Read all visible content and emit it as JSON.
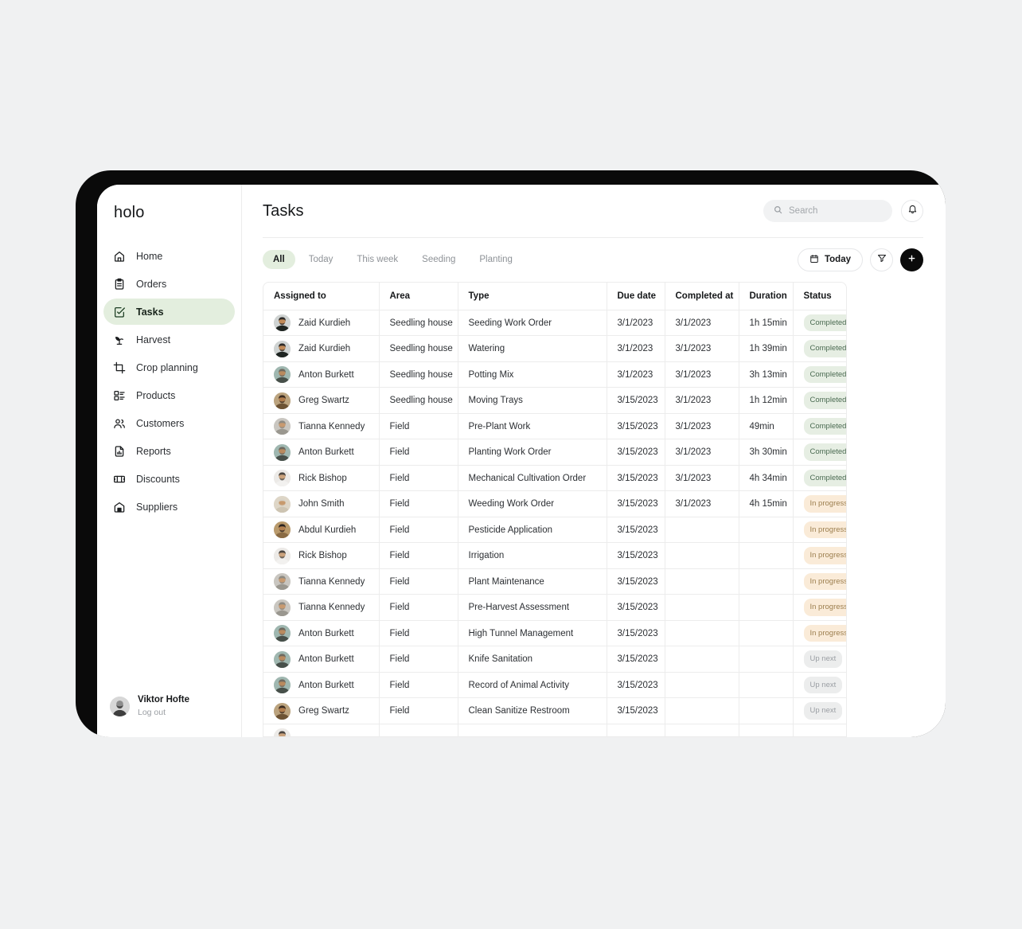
{
  "brand": "holo",
  "sidebar": {
    "items": [
      {
        "label": "Home",
        "icon": "home-icon",
        "active": false
      },
      {
        "label": "Orders",
        "icon": "clipboard-icon",
        "active": false
      },
      {
        "label": "Tasks",
        "icon": "task-check-icon",
        "active": true
      },
      {
        "label": "Harvest",
        "icon": "sprout-icon",
        "active": false
      },
      {
        "label": "Crop planning",
        "icon": "crop-icon",
        "active": false
      },
      {
        "label": "Products",
        "icon": "list-boxes-icon",
        "active": false
      },
      {
        "label": "Customers",
        "icon": "users-icon",
        "active": false
      },
      {
        "label": "Reports",
        "icon": "report-chart-icon",
        "active": false
      },
      {
        "label": "Discounts",
        "icon": "ticket-icon",
        "active": false
      },
      {
        "label": "Suppliers",
        "icon": "warehouse-icon",
        "active": false
      }
    ],
    "profile": {
      "name": "Viktor Hofte",
      "action": "Log out"
    }
  },
  "header": {
    "title": "Tasks",
    "search": {
      "placeholder": "Search",
      "value": "",
      "icon": "search-icon"
    },
    "notifications_icon": "bell-icon"
  },
  "filters": {
    "chips": [
      {
        "label": "All",
        "active": true
      },
      {
        "label": "Today",
        "active": false
      },
      {
        "label": "This week",
        "active": false
      },
      {
        "label": "Seeding",
        "active": false
      },
      {
        "label": "Planting",
        "active": false
      }
    ],
    "today_button": {
      "label": "Today",
      "icon": "calendar-icon"
    },
    "filter_button": {
      "icon": "funnel-icon"
    },
    "add_button": {
      "icon": "plus-icon"
    }
  },
  "table": {
    "columns": [
      "Assigned to",
      "Area",
      "Type",
      "Due date",
      "Completed at",
      "Duration",
      "Status"
    ],
    "rows": [
      {
        "assigned_to": "Zaid Kurdieh",
        "avatar": 0,
        "area": "Seedling house",
        "type": "Seeding Work Order",
        "due_date": "3/1/2023",
        "completed_at": "3/1/2023",
        "duration": "1h 15min",
        "status": "Completed",
        "status_key": "completed"
      },
      {
        "assigned_to": "Zaid Kurdieh",
        "avatar": 0,
        "area": "Seedling house",
        "type": "Watering",
        "due_date": "3/1/2023",
        "completed_at": "3/1/2023",
        "duration": "1h 39min",
        "status": "Completed",
        "status_key": "completed"
      },
      {
        "assigned_to": "Anton Burkett",
        "avatar": 1,
        "area": "Seedling house",
        "type": "Potting Mix",
        "due_date": "3/1/2023",
        "completed_at": "3/1/2023",
        "duration": "3h 13min",
        "status": "Completed",
        "status_key": "completed"
      },
      {
        "assigned_to": "Greg Swartz",
        "avatar": 2,
        "area": "Seedling house",
        "type": "Moving Trays",
        "due_date": "3/15/2023",
        "completed_at": "3/1/2023",
        "duration": "1h 12min",
        "status": "Completed",
        "status_key": "completed"
      },
      {
        "assigned_to": "Tianna Kennedy",
        "avatar": 3,
        "area": "Field",
        "type": "Pre-Plant Work",
        "due_date": "3/15/2023",
        "completed_at": "3/1/2023",
        "duration": "49min",
        "status": "Completed",
        "status_key": "completed"
      },
      {
        "assigned_to": "Anton Burkett",
        "avatar": 1,
        "area": "Field",
        "type": "Planting Work Order",
        "due_date": "3/15/2023",
        "completed_at": "3/1/2023",
        "duration": "3h 30min",
        "status": "Completed",
        "status_key": "completed"
      },
      {
        "assigned_to": "Rick Bishop",
        "avatar": 4,
        "area": "Field",
        "type": "Mechanical Cultivation Order",
        "due_date": "3/15/2023",
        "completed_at": "3/1/2023",
        "duration": "4h 34min",
        "status": "Completed",
        "status_key": "completed"
      },
      {
        "assigned_to": "John Smith",
        "avatar": 5,
        "area": "Field",
        "type": "Weeding Work Order",
        "due_date": "3/15/2023",
        "completed_at": "3/1/2023",
        "duration": "4h 15min",
        "status": "In progress",
        "status_key": "inprogress"
      },
      {
        "assigned_to": "Abdul Kurdieh",
        "avatar": 6,
        "area": "Field",
        "type": "Pesticide Application",
        "due_date": "3/15/2023",
        "completed_at": "",
        "duration": "",
        "status": "In progress",
        "status_key": "inprogress"
      },
      {
        "assigned_to": "Rick Bishop",
        "avatar": 4,
        "area": "Field",
        "type": "Irrigation",
        "due_date": "3/15/2023",
        "completed_at": "",
        "duration": "",
        "status": "In progress",
        "status_key": "inprogress"
      },
      {
        "assigned_to": "Tianna Kennedy",
        "avatar": 3,
        "area": "Field",
        "type": "Plant Maintenance",
        "due_date": "3/15/2023",
        "completed_at": "",
        "duration": "",
        "status": "In progress",
        "status_key": "inprogress"
      },
      {
        "assigned_to": "Tianna Kennedy",
        "avatar": 3,
        "area": "Field",
        "type": "Pre-Harvest Assessment",
        "due_date": "3/15/2023",
        "completed_at": "",
        "duration": "",
        "status": "In progress",
        "status_key": "inprogress"
      },
      {
        "assigned_to": "Anton Burkett",
        "avatar": 1,
        "area": "Field",
        "type": "High Tunnel Management",
        "due_date": "3/15/2023",
        "completed_at": "",
        "duration": "",
        "status": "In progress",
        "status_key": "inprogress"
      },
      {
        "assigned_to": "Anton Burkett",
        "avatar": 1,
        "area": "Field",
        "type": "Knife Sanitation",
        "due_date": "3/15/2023",
        "completed_at": "",
        "duration": "",
        "status": "Up next",
        "status_key": "upnext"
      },
      {
        "assigned_to": "Anton Burkett",
        "avatar": 1,
        "area": "Field",
        "type": "Record of Animal Activity",
        "due_date": "3/15/2023",
        "completed_at": "",
        "duration": "",
        "status": "Up next",
        "status_key": "upnext"
      },
      {
        "assigned_to": "Greg Swartz",
        "avatar": 2,
        "area": "Field",
        "type": "Clean Sanitize Restroom",
        "due_date": "3/15/2023",
        "completed_at": "",
        "duration": "",
        "status": "Up next",
        "status_key": "upnext"
      },
      {
        "assigned_to": "",
        "avatar": 4,
        "area": "",
        "type": "",
        "due_date": "",
        "completed_at": "",
        "duration": "",
        "status": "",
        "status_key": "upnext"
      }
    ]
  },
  "colors": {
    "accent_green": "#e3eede",
    "badge_completed_bg": "#e6eee3",
    "badge_completed_fg": "#4b6b52",
    "badge_inprogress_bg": "#faebd8",
    "badge_inprogress_fg": "#9c7e4e",
    "badge_upnext_bg": "#eceded",
    "badge_upnext_fg": "#9a9ea3",
    "page_bg": "#f0f1f2",
    "frame": "#0a0a0a"
  }
}
